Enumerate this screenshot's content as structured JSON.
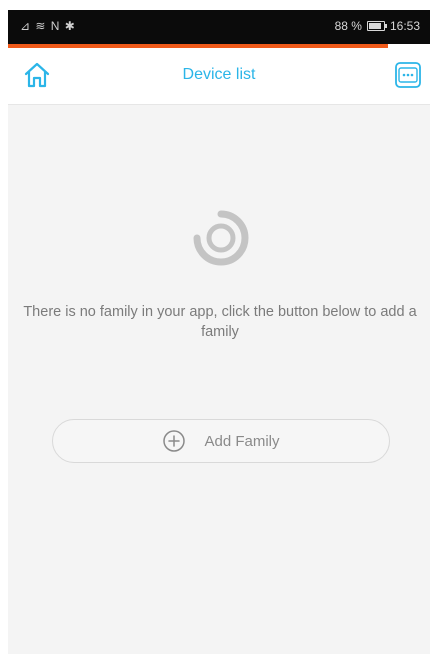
{
  "status_bar": {
    "left_icons": "signal-wifi-nfc-bluetooth",
    "left_text": "⊿ ≋ N ✱",
    "battery_percent": "88 %",
    "time": "16:53"
  },
  "progress": {
    "value": 0.9,
    "color": "#f05a1a"
  },
  "header": {
    "title": "Device list",
    "home_icon": "home-icon",
    "device_icon": "device-scan-icon",
    "accent": "#2bb5e8"
  },
  "main": {
    "empty_icon": "loading-ring-icon",
    "empty_message": "There is no family in your app, click the button below to add a family",
    "add_family_label": "Add Family",
    "add_family_icon": "plus-circle-icon"
  }
}
